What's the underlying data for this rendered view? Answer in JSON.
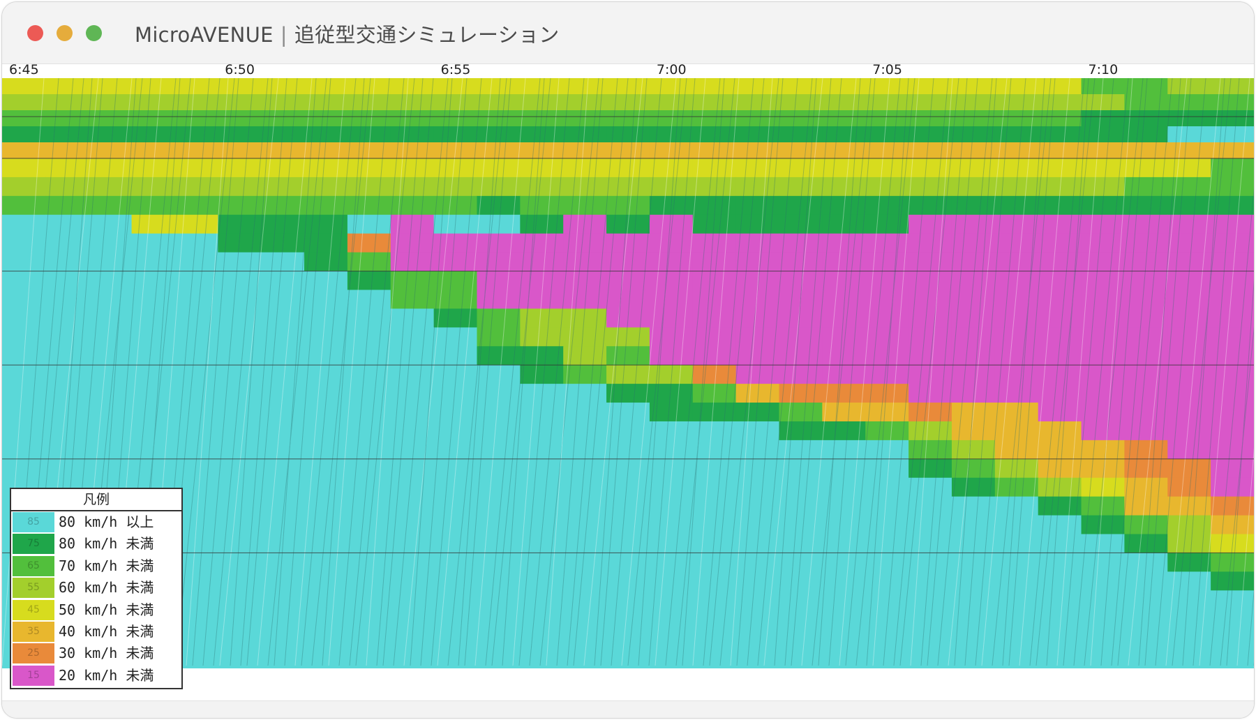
{
  "window": {
    "app_name": "MicroAVENUE",
    "separator": "|",
    "subtitle": "追従型交通シミュレーション"
  },
  "colors": {
    "ge80": "#5ad8d8",
    "lt80": "#1fa64a",
    "lt70": "#52bf3c",
    "lt60": "#a3cf2c",
    "lt50": "#d7dc1e",
    "lt40": "#e8b72e",
    "lt30": "#e98a3a",
    "lt20": "#d957c9"
  },
  "legend": {
    "title": "凡例",
    "items": [
      {
        "sample": "85",
        "label": "80 km/h 以上",
        "color_key": "ge80"
      },
      {
        "sample": "75",
        "label": "80 km/h 未満",
        "color_key": "lt80"
      },
      {
        "sample": "65",
        "label": "70 km/h 未満",
        "color_key": "lt70"
      },
      {
        "sample": "55",
        "label": "60 km/h 未満",
        "color_key": "lt60"
      },
      {
        "sample": "45",
        "label": "50 km/h 未満",
        "color_key": "lt50"
      },
      {
        "sample": "35",
        "label": "40 km/h 未満",
        "color_key": "lt40"
      },
      {
        "sample": "25",
        "label": "30 km/h 未満",
        "color_key": "lt30"
      },
      {
        "sample": "15",
        "label": "20 km/h 未満",
        "color_key": "lt20"
      }
    ]
  },
  "chart_data": {
    "type": "heatmap",
    "x_ticks": [
      "6:45",
      "6:50",
      "6:55",
      "7:00",
      "7:05",
      "7:10"
    ],
    "time_range": [
      "6:45",
      "7:14"
    ],
    "rows": 27,
    "cols": 29,
    "cell_minutes": 1,
    "grid": true,
    "legend_position": "bottom-left",
    "class_order": [
      "lt20",
      "lt30",
      "lt40",
      "lt50",
      "lt60",
      "lt70",
      "lt80",
      "ge80"
    ],
    "upper_band": [
      "3333333333333333333333333554",
      "4444444444444444444444444455",
      "5555555555555555555555555666",
      "6666666666666666666666666667",
      "2222222222222222222222222222"
    ],
    "grid_rows": [
      "33333333333333333333333333335",
      "44444444444444444444444444555",
      "55555555555655566666666666666",
      "77733666707760606666600000000",
      "77777666100000000000000000000",
      "77777776500000000000000000000",
      "77777777655000000000000000000",
      "77777777755000000000000000000",
      "77777777776544000000000000000",
      "77777777777544400000000000000",
      "77777777777664500000000000000",
      "77777777777765441000000000000",
      "77777777777777665211100000000",
      "77777777777777766652212200000",
      "77777777777777777766542220000",
      "77777777777777777777754222100",
      "77777777777777777777765422110",
      "77777777777777777777776543210",
      "77777777777777777777777765221",
      "77777777777777777777777776542",
      "77777777777777777777777777643",
      "77777777777777777777777777765",
      "77777777777777777777777777776",
      "77777777777777777777777777777",
      "77777777777777777777777777777",
      "77777777777777777777777777777",
      "77777777777777777777777777777"
    ]
  }
}
